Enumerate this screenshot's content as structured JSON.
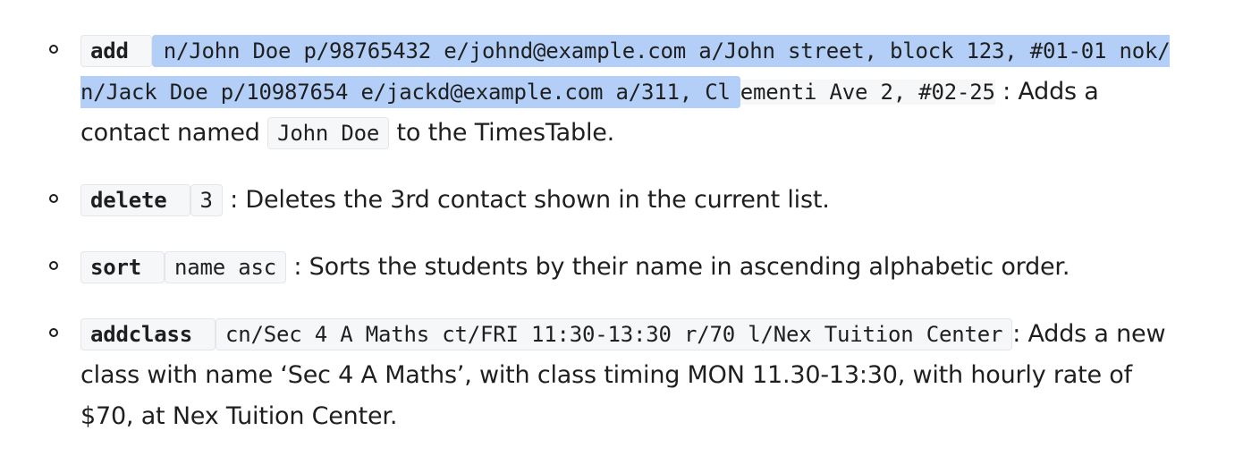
{
  "items": [
    {
      "command": "add",
      "args_selected": "n/John Doe p/98765432 e/johnd@example.com a/John street, block 123, #01-01 nok/ n/Jack Doe p/10987654 e/jackd@example.com a/311, Cl",
      "args_unselected": "ementi Ave 2, #02-25",
      "text_before": " : Adds a contact named ",
      "inline_code": "John Doe",
      "text_after": " to the TimesTable."
    },
    {
      "command": "delete",
      "args": "3",
      "description": " : Deletes the 3rd contact shown in the current list."
    },
    {
      "command": "sort",
      "args": "name asc",
      "description": " : Sorts the students by their name in ascending alphabetic order."
    },
    {
      "command": "addclass",
      "args": "cn/Sec 4 A Maths ct/FRI 11:30-13:30 r/70 l/Nex Tuition Center",
      "description": ": Adds a new class with name ‘Sec 4 A Maths’, with class timing MON 11.30-13:30, with hourly rate of $70, at Nex Tuition Center."
    }
  ],
  "colors": {
    "selection": "#b3cff7",
    "code_background": "#f6f7f9"
  }
}
